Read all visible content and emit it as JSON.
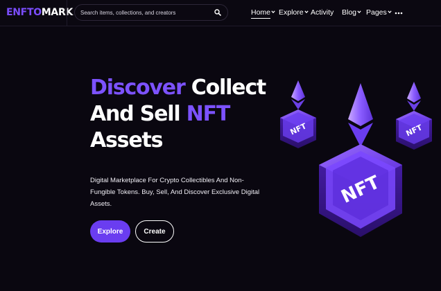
{
  "brand": {
    "logo_accent": "ENFTO",
    "logo_rest": "MARK",
    "accent_color": "#7b4dff"
  },
  "search": {
    "placeholder": "Search items, collections, and creators",
    "icon": "search-icon"
  },
  "nav": {
    "items": [
      {
        "label": "Home",
        "dropdown": true,
        "active": true
      },
      {
        "label": "Explore",
        "dropdown": true,
        "active": false
      },
      {
        "label": "Activity",
        "dropdown": false,
        "active": false
      },
      {
        "label": "Blog",
        "dropdown": true,
        "active": false
      },
      {
        "label": "Pages",
        "dropdown": true,
        "active": false
      }
    ],
    "more_icon": "more-dots-icon"
  },
  "hero": {
    "title_word1": "Discover",
    "title_word2": " Collect",
    "title_word3": "And Sell ",
    "title_word4": "NFT",
    "title_word5": "Assets",
    "description": "Digital Marketplace For Crypto Collectibles And Non-Fungible Tokens. Buy, Sell, And Discover Exclusive Digital Assets.",
    "explore_label": "Explore",
    "create_label": "Create"
  },
  "illustration": {
    "badge_text": "NFT",
    "icon": "ethereum-nft-icon"
  },
  "colors": {
    "background": "#0a0710",
    "primary": "#6a3df0",
    "highlight": "#7c52ff"
  }
}
